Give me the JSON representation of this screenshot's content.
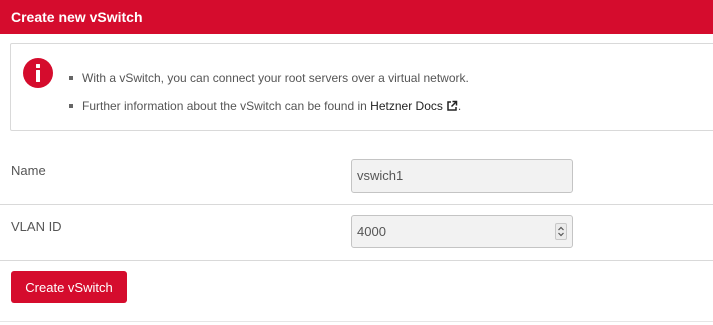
{
  "panel": {
    "title": "Create new vSwitch"
  },
  "info": {
    "icon": "exclamation-icon",
    "line1": "With a vSwitch, you can connect your root servers over a virtual network.",
    "line2_prefix": "Further information about the vSwitch can be found in ",
    "line2_link": "Hetzner Docs",
    "line2_suffix": ".",
    "link_icon": "external-link-icon"
  },
  "form": {
    "name_label": "Name",
    "name_value": "vswich1",
    "vlan_label": "VLAN ID",
    "vlan_value": "4000",
    "vlan_spinner_icon": "spinner-arrows-icon"
  },
  "actions": {
    "submit_label": "Create vSwitch"
  },
  "colors": {
    "brand_red": "#d50c2d",
    "text_gray": "#555555",
    "field_bg": "#f2f2f2",
    "border": "#d9d9d9"
  }
}
